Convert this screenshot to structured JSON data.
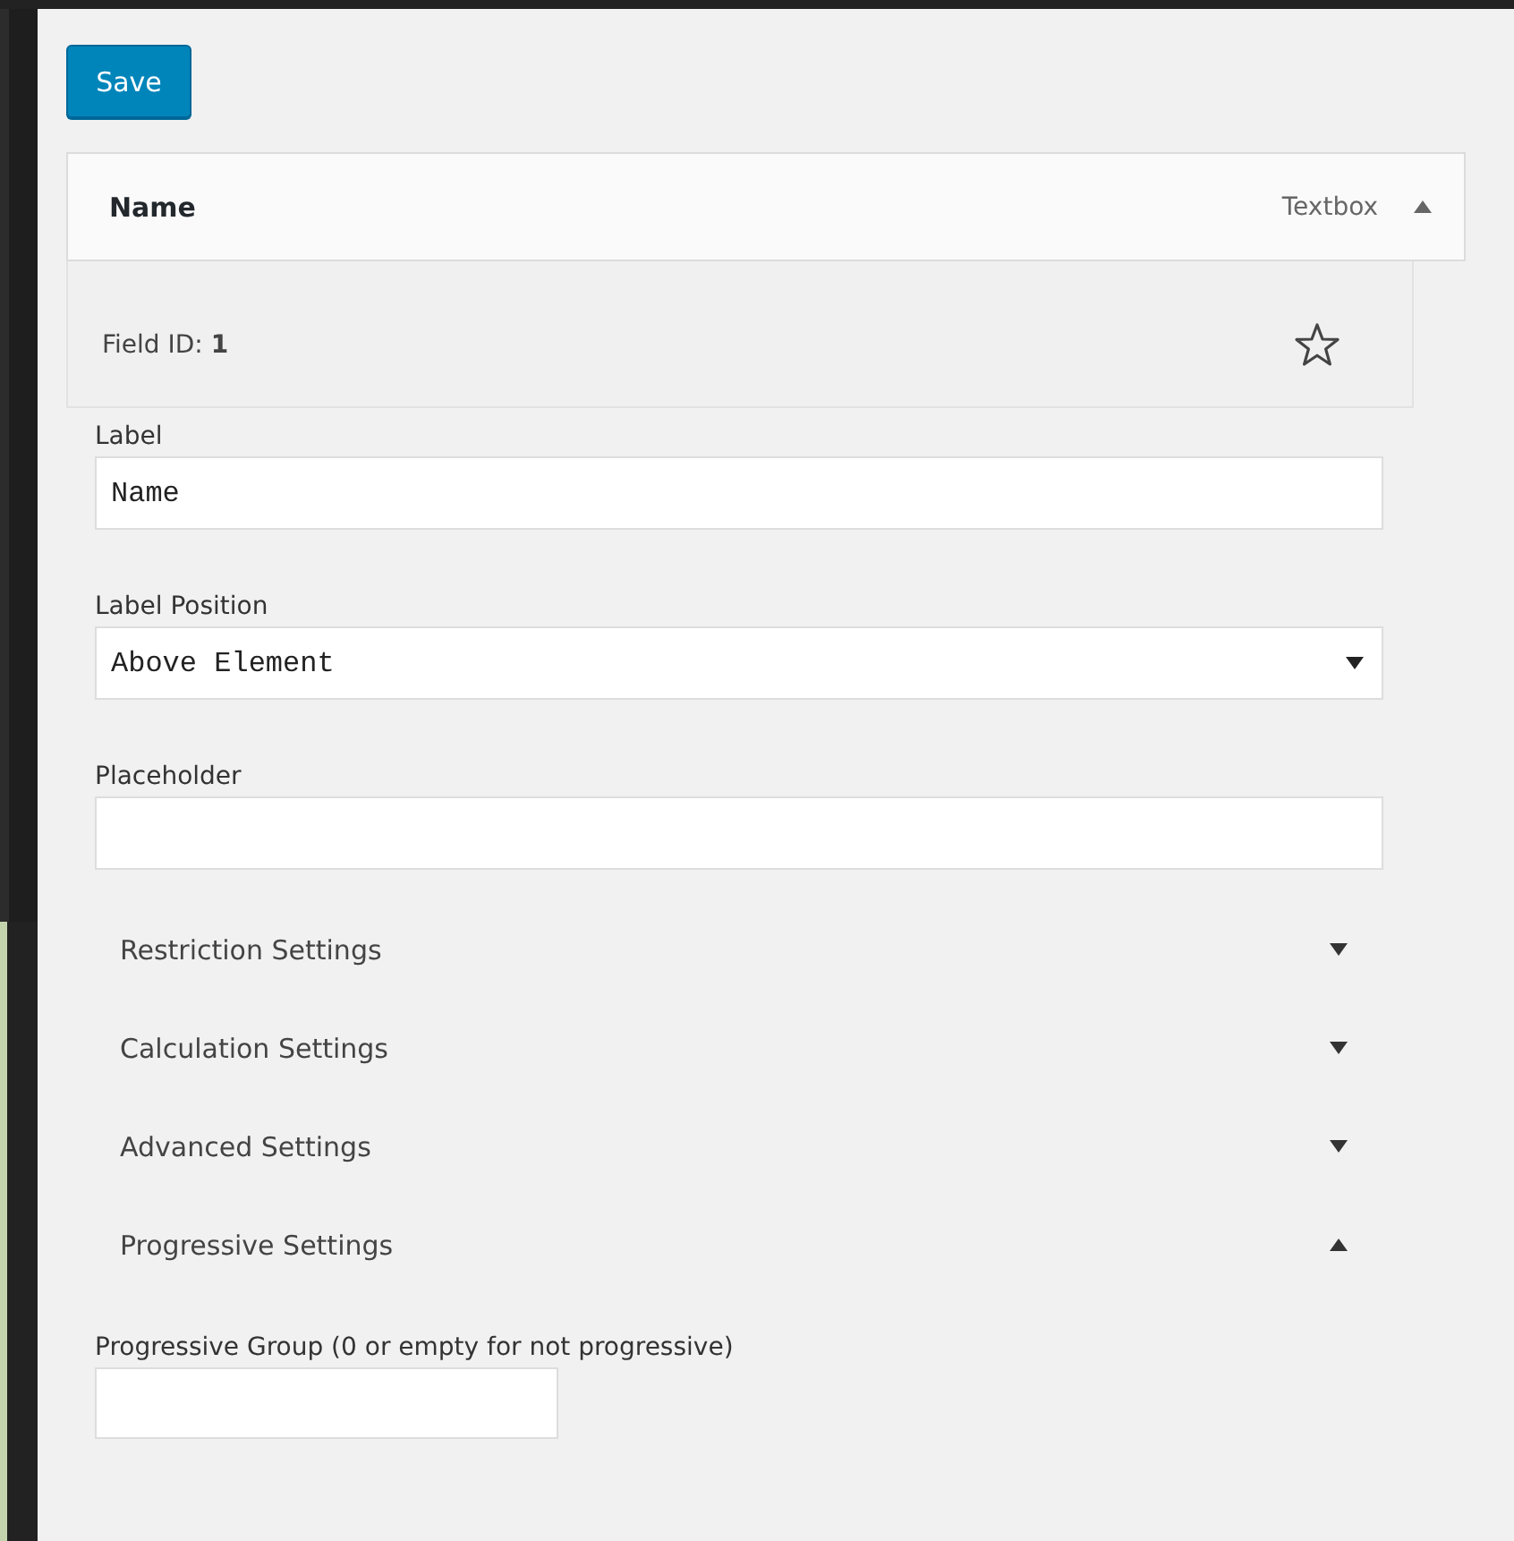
{
  "save_button": "Save",
  "field_header": {
    "title": "Name",
    "type": "Textbox",
    "expanded": true
  },
  "field_id": "Field ID: **1**",
  "fields": [
    {
      "kind": "text",
      "label": "Label",
      "value": "Name"
    },
    {
      "kind": "select",
      "label": "Label Position",
      "value": "Above Element"
    },
    {
      "kind": "text",
      "label": "Placeholder"
    }
  ],
  "sections": [
    {
      "title": "Restriction Settings",
      "expanded": false
    },
    {
      "title": "Calculation Settings",
      "expanded": false
    },
    {
      "title": "Advanced Settings",
      "expanded": false
    },
    {
      "title": "Progressive Settings",
      "expanded": true
    }
  ],
  "progressive_group": {
    "label": "Progressive Group (0 or empty for not progressive)"
  }
}
